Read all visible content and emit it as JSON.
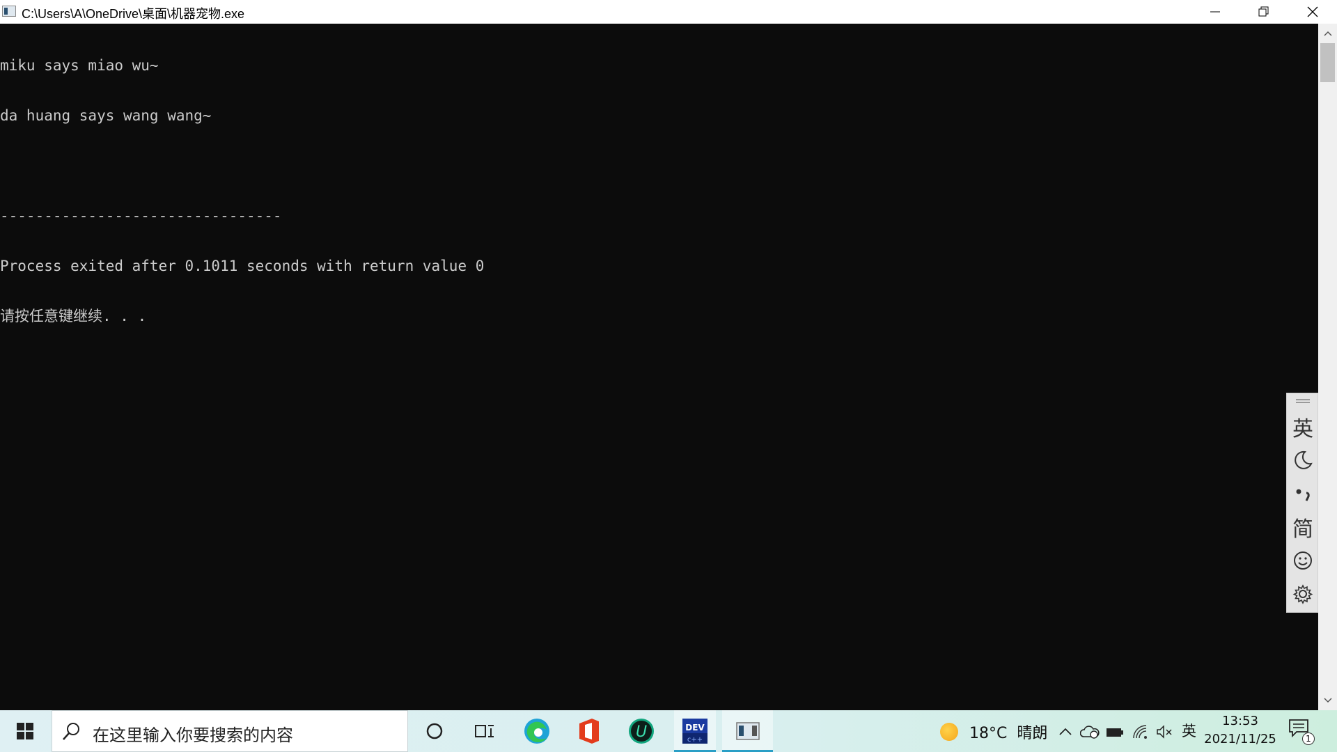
{
  "window": {
    "title": "C:\\Users\\A\\OneDrive\\桌面\\机器宠物.exe"
  },
  "console": {
    "lines": [
      "miku says miao wu~",
      "da huang says wang wang~",
      "",
      "--------------------------------",
      "Process exited after 0.1011 seconds with return value 0",
      "请按任意键继续. . ."
    ]
  },
  "ime_toolbar": {
    "items": [
      {
        "icon": "lang-english-icon",
        "label": "英"
      },
      {
        "icon": "moon-icon",
        "label": "☽"
      },
      {
        "icon": "punctuation-icon",
        "label": "•,"
      },
      {
        "icon": "simplified-icon",
        "label": "简"
      },
      {
        "icon": "emoji-icon",
        "label": "☺"
      },
      {
        "icon": "gear-icon",
        "label": "⚙"
      }
    ]
  },
  "taskbar": {
    "search_placeholder": "在这里输入你要搜索的内容",
    "apps": [
      {
        "icon": "cortana-icon"
      },
      {
        "icon": "task-view-icon"
      },
      {
        "icon": "edge-icon"
      },
      {
        "icon": "office-icon"
      },
      {
        "icon": "u-app-icon"
      },
      {
        "icon": "dev-cpp-icon",
        "label": "DEV"
      },
      {
        "icon": "console-app-icon"
      }
    ],
    "weather": {
      "temp": "18°C",
      "condition": "晴朗"
    },
    "ime_indicator": "英",
    "clock": {
      "time": "13:53",
      "date": "2021/11/25"
    },
    "notification_count": "1"
  },
  "colors": {
    "console_bg": "#0c0c0c",
    "console_fg": "#cccccc",
    "accent": "#2a9fc6"
  }
}
